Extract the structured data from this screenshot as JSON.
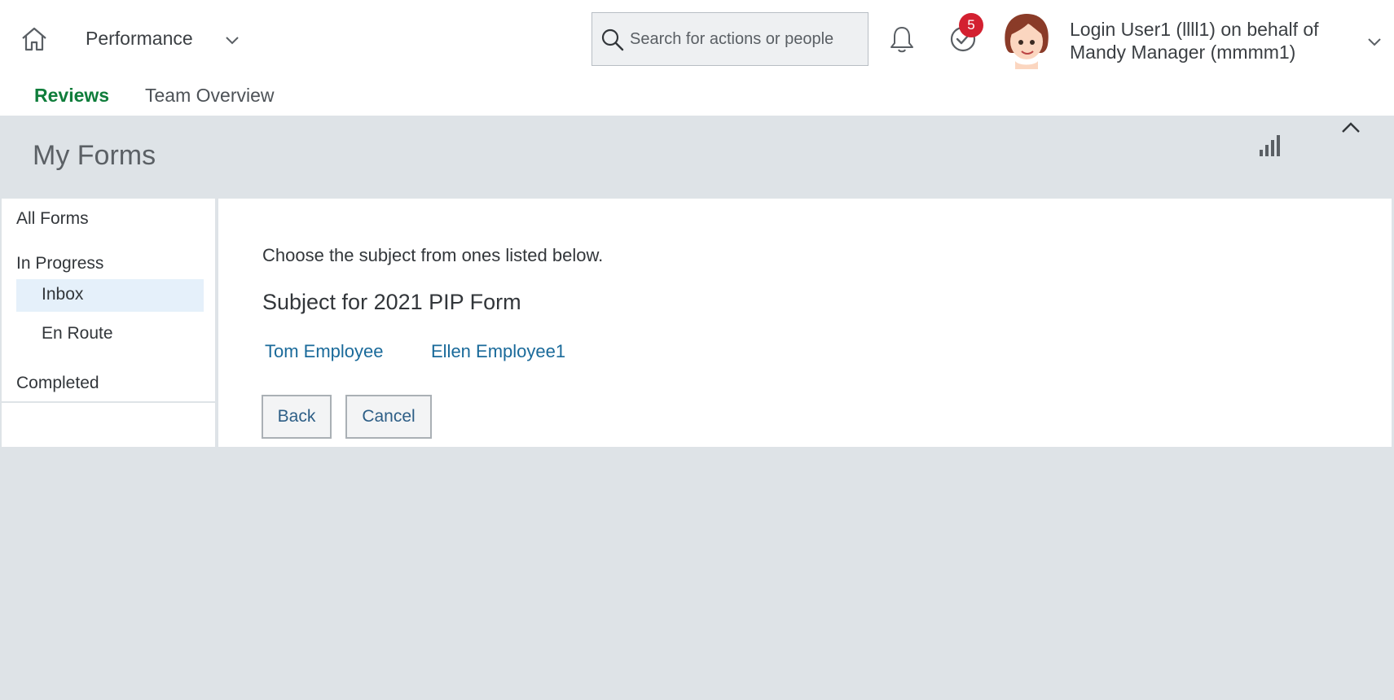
{
  "shell": {
    "module_title": "Performance",
    "search_placeholder": "Search for actions or people",
    "todo_count": "5",
    "user_name": "Login User1 (llll1) on behalf of Mandy Manager (mmmm1)"
  },
  "tabs": [
    {
      "label": "Reviews",
      "selected": true
    },
    {
      "label": "Team Overview",
      "selected": false
    }
  ],
  "page": {
    "title": "My Forms"
  },
  "leftnav": {
    "all_forms": "All Forms",
    "in_progress": "In Progress",
    "inbox": "Inbox",
    "en_route": "En Route",
    "completed": "Completed"
  },
  "content": {
    "instruction": "Choose the subject from ones listed below.",
    "subject_heading": "Subject for 2021 PIP Form",
    "subjects": [
      "Tom Employee",
      "Ellen Employee1"
    ],
    "back_label": "Back",
    "cancel_label": "Cancel"
  },
  "colors": {
    "accent_tab": "#0f7d3b",
    "link": "#1a6a9a",
    "badge": "#d32030",
    "selected_nav_bg": "#e5f0fa",
    "background": "#dee3e7"
  },
  "icons": [
    "home-icon",
    "chevron-down-icon",
    "search-icon",
    "bell-icon",
    "todo-check-icon",
    "user-avatar",
    "bar-chart-icon",
    "chevron-up-icon"
  ]
}
